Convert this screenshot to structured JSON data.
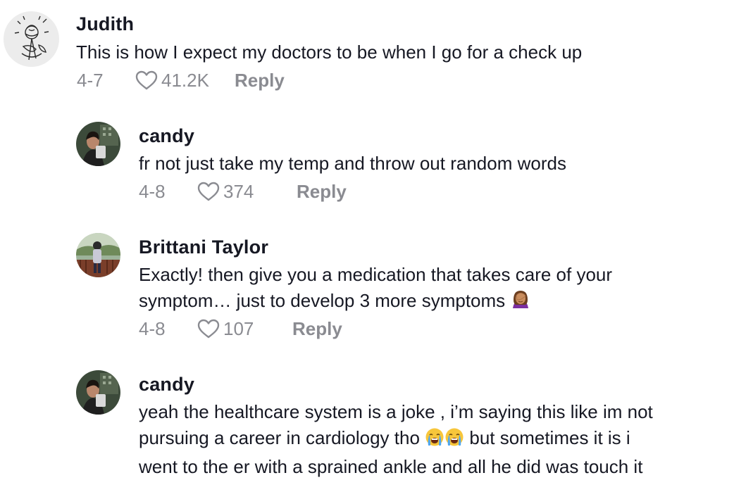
{
  "comments": [
    {
      "author": "Judith",
      "lines": [
        "This is how I expect my doctors to be when I go for a check up"
      ],
      "date": "4-7",
      "likes": "41.2K",
      "reply_label": "Reply",
      "avatar_icon": "rose-sketch-avatar"
    },
    {
      "author": "candy",
      "lines": [
        "fr not just take my temp and throw out random words"
      ],
      "date": "4-8",
      "likes": "374",
      "reply_label": "Reply",
      "avatar_icon": "selfie-avatar"
    },
    {
      "author": "Brittani Taylor",
      "lines": [
        "Exactly! then give you a medication that takes care of your",
        "symptom… just to develop 3 more symptoms"
      ],
      "emoji": [
        "woman-facepalming-emoji"
      ],
      "date": "4-8",
      "likes": "107",
      "reply_label": "Reply",
      "avatar_icon": "outdoor-photo-avatar"
    },
    {
      "author": "candy",
      "lines": [
        "yeah the healthcare system is a joke , i’m saying this like im not",
        "pursuing a career in cardiology tho",
        "but sometimes it is i",
        "went to the er with a sprained ankle and all he did was touch it"
      ],
      "emoji": [
        "loudly-crying-face-emoji",
        "loudly-crying-face-emoji"
      ],
      "avatar_icon": "selfie-avatar"
    }
  ],
  "colors": {
    "text": "#161823",
    "meta": "#8a8b91",
    "background": "#ffffff"
  }
}
